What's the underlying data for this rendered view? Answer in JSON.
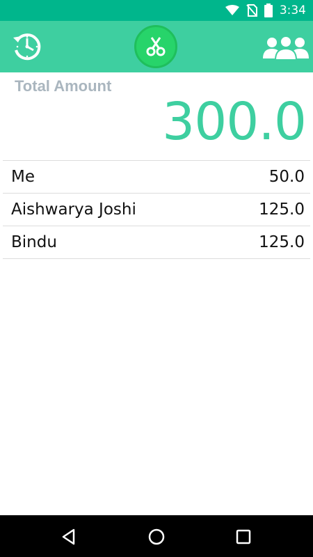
{
  "status_bar": {
    "time": "3:34",
    "icons": [
      "wifi-icon",
      "no-sim-icon",
      "battery-icon"
    ]
  },
  "app_bar": {
    "background": "#3ecfa0",
    "left_icon": "history-clock-icon",
    "center_icon": "scissors-icon",
    "right_icon": "people-group-icon"
  },
  "total": {
    "label": "Total Amount",
    "value": "300.0"
  },
  "members": [
    {
      "name": "Me",
      "amount": "50.0"
    },
    {
      "name": "Aishwarya Joshi",
      "amount": "125.0"
    },
    {
      "name": "Bindu",
      "amount": "125.0"
    }
  ],
  "nav_bar": {
    "icons": [
      "back-icon",
      "home-icon",
      "recents-icon"
    ]
  }
}
